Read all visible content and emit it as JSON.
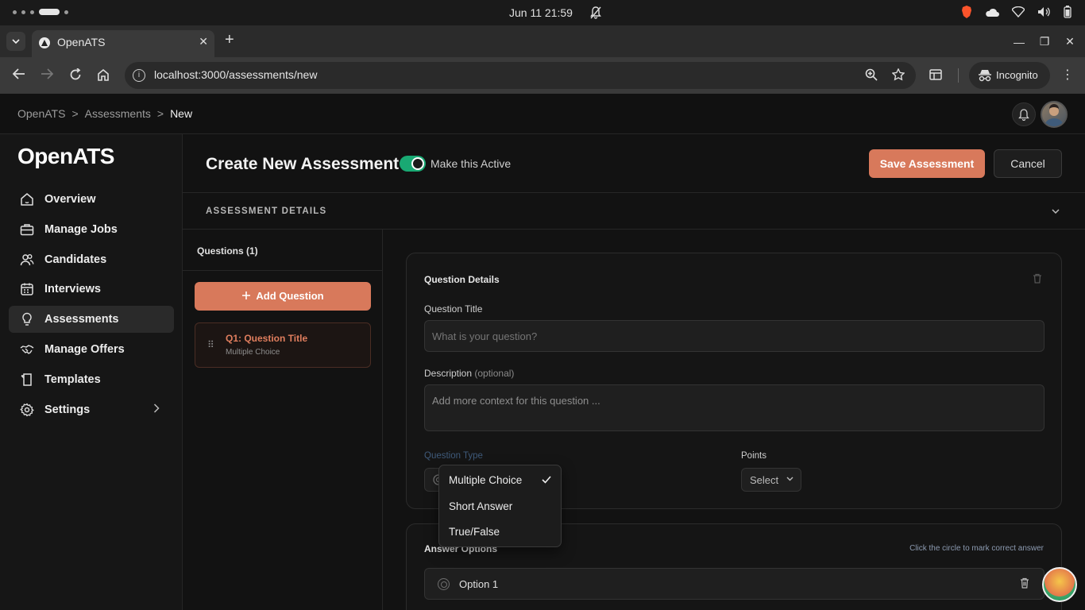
{
  "os": {
    "clock": "Jun 11  21:59"
  },
  "browser": {
    "tab_title": "OpenATS",
    "url": "localhost:3000/assessments/new",
    "incognito_label": "Incognito"
  },
  "header": {
    "breadcrumbs": [
      "OpenATS",
      ">",
      "Assessments",
      ">",
      "New"
    ]
  },
  "sidebar": {
    "brand": "OpenATS",
    "items": [
      {
        "label": "Overview",
        "icon": "home-icon"
      },
      {
        "label": "Manage Jobs",
        "icon": "briefcase-icon"
      },
      {
        "label": "Candidates",
        "icon": "users-icon"
      },
      {
        "label": "Interviews",
        "icon": "calendar-icon"
      },
      {
        "label": "Assessments",
        "icon": "lightbulb-icon",
        "active": true
      },
      {
        "label": "Manage Offers",
        "icon": "handshake-icon"
      },
      {
        "label": "Templates",
        "icon": "template-icon"
      },
      {
        "label": "Settings",
        "icon": "gear-icon"
      }
    ]
  },
  "main": {
    "title": "Create New Assessment",
    "active_toggle_label": "Make this Active",
    "active_toggle_on": true,
    "save_label": "Save Assessment",
    "cancel_label": "Cancel",
    "details_section": "ASSESSMENT DETAILS"
  },
  "questions": {
    "header": "Questions (1)",
    "add_label": "Add Question",
    "list": [
      {
        "title": "Q1: Question Title",
        "type": "Multiple Choice"
      }
    ]
  },
  "question_details": {
    "title": "Question Details",
    "question_title_label": "Question Title",
    "question_title_placeholder": "What is your question?",
    "description_label": "Description",
    "description_optional": "(optional)",
    "description_placeholder": "Add more context for this question ...",
    "question_type_label": "Question Type",
    "points_label": "Points",
    "points_value": "Select"
  },
  "question_type_dropdown": {
    "options": [
      "Multiple Choice",
      "Short Answer",
      "True/False"
    ],
    "selected": "Multiple Choice"
  },
  "answer_options": {
    "title": "Answer Options",
    "hint": "Click the circle to mark correct answer",
    "options": [
      "Option 1"
    ]
  },
  "colors": {
    "accent": "#d8795b",
    "toggle_on": "#19a973"
  }
}
